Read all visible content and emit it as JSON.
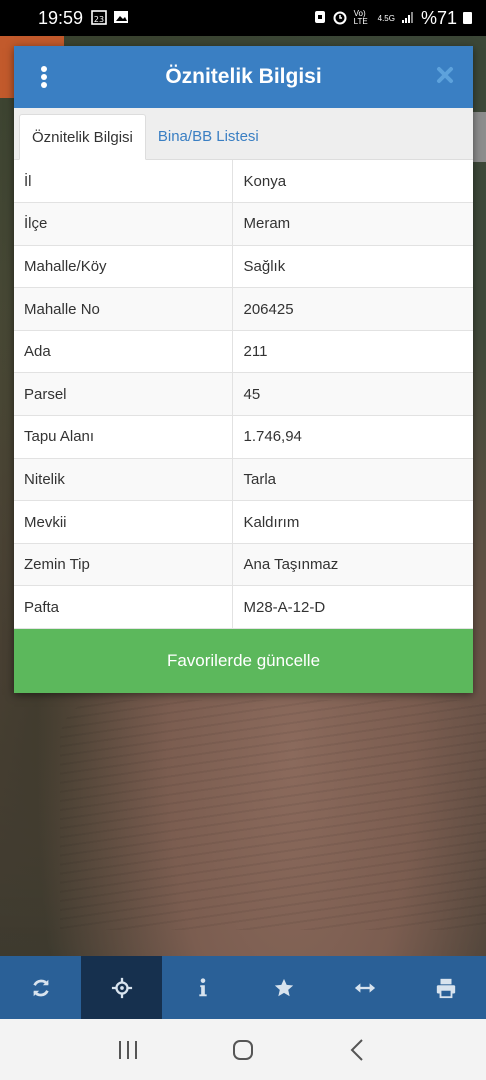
{
  "status_bar": {
    "time": "19:59",
    "battery_text": "%71",
    "network_label": "4.5G",
    "volte_label": "Vo) LTE"
  },
  "dialog": {
    "title": "Öznitelik Bilgisi",
    "tabs": [
      {
        "label": "Öznitelik Bilgisi",
        "active": true
      },
      {
        "label": "Bina/BB Listesi",
        "active": false
      }
    ],
    "rows": [
      {
        "key": "İl",
        "value": "Konya"
      },
      {
        "key": "İlçe",
        "value": "Meram"
      },
      {
        "key": "Mahalle/Köy",
        "value": "Sağlık"
      },
      {
        "key": "Mahalle No",
        "value": "206425"
      },
      {
        "key": "Ada",
        "value": "211"
      },
      {
        "key": "Parsel",
        "value": "45"
      },
      {
        "key": "Tapu Alanı",
        "value": "1.746,94"
      },
      {
        "key": "Nitelik",
        "value": "Tarla"
      },
      {
        "key": "Mevkii",
        "value": "Kaldırım"
      },
      {
        "key": "Zemin Tip",
        "value": "Ana Taşınmaz"
      },
      {
        "key": "Pafta",
        "value": "M28-A-12-D"
      }
    ],
    "favorite_button": "Favorilerde güncelle"
  },
  "toolbar": {
    "items": [
      {
        "icon": "refresh-icon",
        "active": false
      },
      {
        "icon": "locate-icon",
        "active": true
      },
      {
        "icon": "info-icon",
        "active": false
      },
      {
        "icon": "star-icon",
        "active": false
      },
      {
        "icon": "measure-icon",
        "active": false
      },
      {
        "icon": "print-icon",
        "active": false
      }
    ]
  },
  "colors": {
    "header_blue": "#3a7fc3",
    "button_green": "#5cb85c",
    "toolbar_blue": "#2a6097",
    "toolbar_active": "#16304e"
  }
}
